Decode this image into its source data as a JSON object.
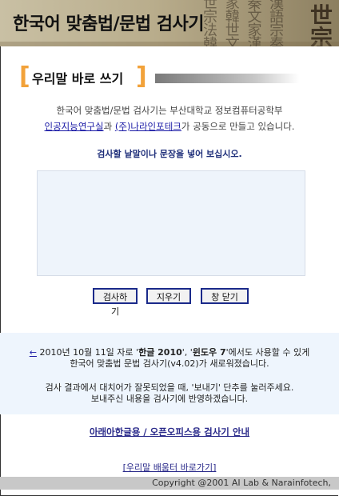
{
  "header": {
    "title": "한국어 맞춤법/문법 검사기",
    "decoration_glyphs": "世 家 秦 漢 宗 韓 文 語 法"
  },
  "section": {
    "title": "우리말 바로 쓰기"
  },
  "intro": {
    "line1": "한국어 맞춤법/문법 검사기는 부산대학교 정보컴퓨터공학부",
    "link1": "인공지능연구실",
    "connector": "과",
    "link2": "(주)나라인포테크",
    "line2_end": "가 공동으로 만들고 있습니다."
  },
  "instruction": "검사할 낱말이나 문장을 넣어 보십시오.",
  "input": {
    "value": "",
    "placeholder": ""
  },
  "buttons": {
    "check": "검사하기",
    "clear": "지우기",
    "close": "창 닫기"
  },
  "notice": {
    "arrow": "←",
    "line1_prefix": " 2010년 10월 11일 자로 '",
    "bold1": "한글 2010",
    "sep": "', '",
    "bold2": "윈도우 7",
    "line1_suffix": "'에서도 사용할 수 있게",
    "line2": "한국어 맞춤법 문법 검사기(v4.02)가 새로워졌습니다.",
    "line3": "검사 결과에서 대치어가 잘못되었을 때, '보내기' 단추를 눌러주세요.",
    "line4": "보내주신 내용을 검사기에 반영하겠습니다."
  },
  "guide_link": "아래아한글용 / 오픈오피스용 검사기 안내",
  "shortcut_link": "[우리말 배움터 바로가기]",
  "footer": "Copyright @2001 AI Lab & Narainfotech,"
}
